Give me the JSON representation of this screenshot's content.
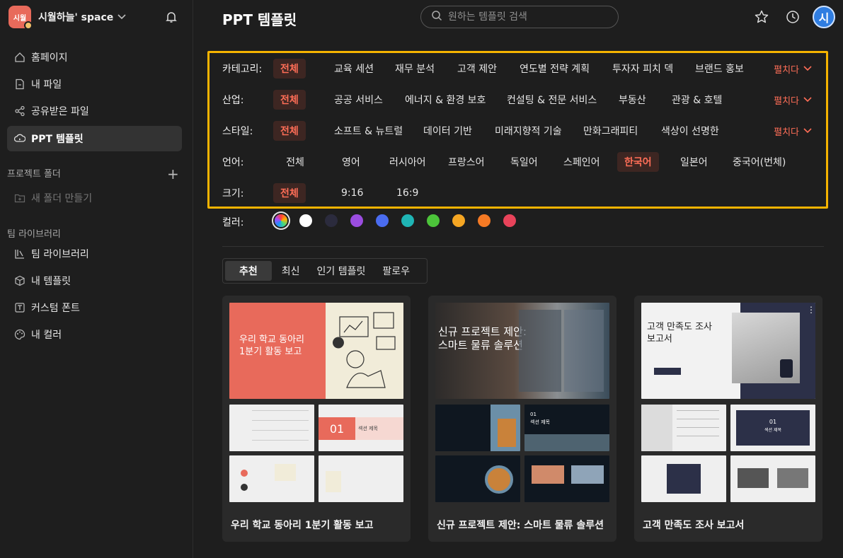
{
  "sidebar": {
    "space_initials": "시월",
    "space_name": "시월하늘' space",
    "nav": [
      {
        "label": "홈페이지",
        "icon": "home-icon"
      },
      {
        "label": "내 파일",
        "icon": "file-icon"
      },
      {
        "label": "공유받은 파일",
        "icon": "share-icon"
      },
      {
        "label": "PPT 템플릿",
        "icon": "ppt-template-icon"
      }
    ],
    "project_folder_label": "프로젝트 폴더",
    "new_folder_label": "새 폴더 만들기",
    "team_library_label": "팀 라이브러리",
    "library_items": [
      {
        "label": "팀 라이브러리",
        "icon": "team-library-icon"
      },
      {
        "label": "내 템플릿",
        "icon": "cube-icon"
      },
      {
        "label": "커스텀 폰트",
        "icon": "font-icon"
      },
      {
        "label": "내 컬러",
        "icon": "palette-icon"
      }
    ]
  },
  "header": {
    "title": "PPT 템플릿",
    "search_placeholder": "원하는 템플릿 검색",
    "user_initial": "시"
  },
  "filters": {
    "expand_label": "펼치다",
    "category": {
      "label": "카테고리:",
      "options": [
        "전체",
        "교육 세션",
        "재무 분석",
        "고객 제안",
        "연도별 전략 계획",
        "투자자 피치 덱",
        "브랜드 홍보"
      ]
    },
    "industry": {
      "label": "산업:",
      "options": [
        "전체",
        "공공 서비스",
        "에너지 & 환경 보호",
        "컨설팅 & 전문 서비스",
        "부동산",
        "관광 & 호텔"
      ]
    },
    "style": {
      "label": "스타일:",
      "options": [
        "전체",
        "소프트 & 뉴트럴",
        "데이터 기반",
        "미래지향적 기술",
        "만화그래피티",
        "색상이 선명한"
      ]
    },
    "language": {
      "label": "언어:",
      "options": [
        "전체",
        "영어",
        "러시아어",
        "프랑스어",
        "독일어",
        "스페인어",
        "한국어",
        "일본어",
        "중국어(번체)"
      ]
    },
    "size": {
      "label": "크기:",
      "options": [
        "전체",
        "9:16",
        "16:9"
      ]
    },
    "color": {
      "label": "컬러:",
      "swatches": [
        "rainbow",
        "#ffffff",
        "#2b2b3d",
        "#9b4de0",
        "#4a6cf0",
        "#1fb5b5",
        "#4cc43a",
        "#f5a623",
        "#f57a24",
        "#e8435a"
      ]
    }
  },
  "tabs": [
    "추천",
    "최신",
    "인기 템플릿",
    "팔로우"
  ],
  "templates": [
    {
      "title": "우리 학교 동아리 1분기 활동 보고",
      "cover_text": "우리 학교 동아리\n1분기 활동 보고",
      "section_num": "01",
      "section_label": "섹션 제목"
    },
    {
      "title": "신규 프로젝트 제안: 스마트 물류 솔루션",
      "cover_text": "신규 프로젝트 제안:\n스마트 물류 솔루션",
      "section_num": "01",
      "section_label": "섹션 제목"
    },
    {
      "title": "고객 만족도 조사 보고서",
      "cover_text": "고객 만족도 조사\n보고서",
      "section_num": "01",
      "section_label": "섹션 제목"
    }
  ]
}
